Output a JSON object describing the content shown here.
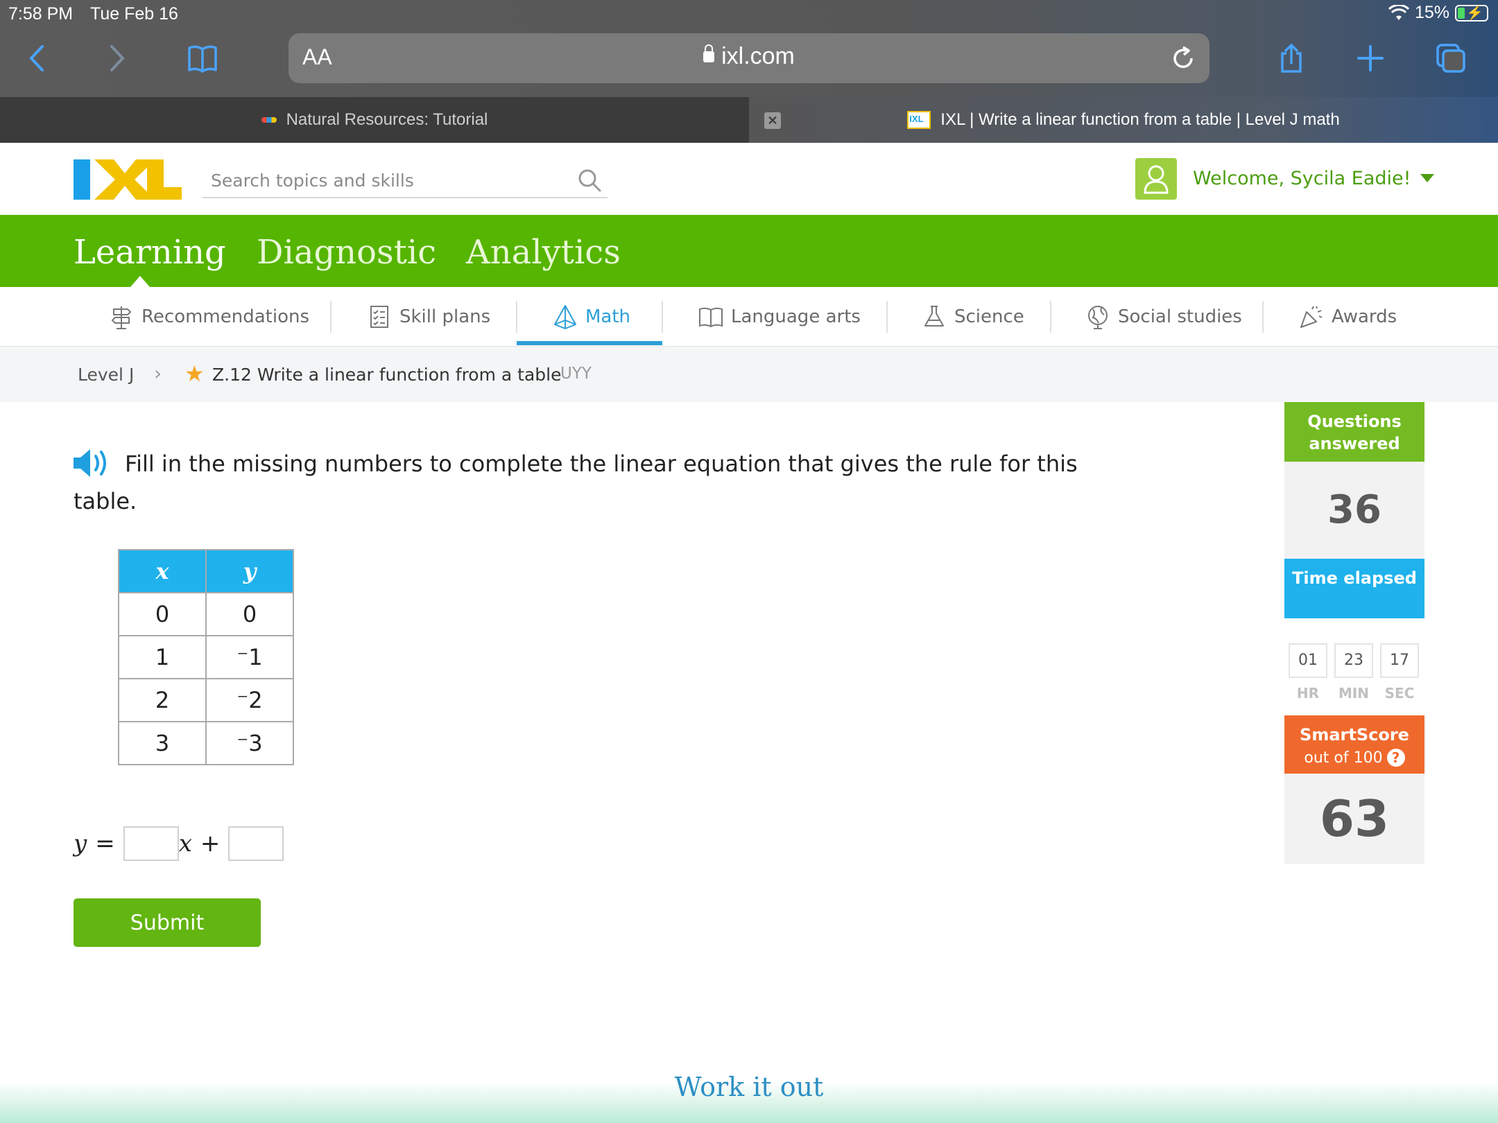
{
  "status": {
    "time": "7:58 PM",
    "date": "Tue Feb 16",
    "battery": "15%"
  },
  "browser": {
    "aa_label": "AA",
    "url": "ixl.com",
    "tabs": [
      {
        "title": "Natural Resources: Tutorial",
        "active": false
      },
      {
        "title": "IXL | Write a linear function from a table | Level J math",
        "active": true
      }
    ]
  },
  "header": {
    "search_placeholder": "Search topics and skills",
    "welcome": "Welcome, Sycila Eadie!"
  },
  "main_nav": {
    "items": [
      "Learning",
      "Diagnostic",
      "Analytics"
    ],
    "active": "Learning"
  },
  "subject_tabs": {
    "items": [
      "Recommendations",
      "Skill plans",
      "Math",
      "Language arts",
      "Science",
      "Social studies",
      "Awards"
    ],
    "active": "Math"
  },
  "breadcrumb": {
    "level": "Level J",
    "skill": "Z.12 Write a linear function from a table",
    "code": "UYY"
  },
  "question": {
    "prompt": "Fill in the missing numbers to complete the linear equation that gives the rule for this table.",
    "table": {
      "headers": [
        "x",
        "y"
      ],
      "rows": [
        [
          "0",
          "0"
        ],
        [
          "1",
          "⁻1"
        ],
        [
          "2",
          "⁻2"
        ],
        [
          "3",
          "⁻3"
        ]
      ]
    },
    "equation": {
      "lhs": "y",
      "eq": "=",
      "var": "x",
      "plus": "+"
    },
    "submit_label": "Submit"
  },
  "stats": {
    "questions_label": "Questions answered",
    "questions_value": "36",
    "time_label": "Time elapsed",
    "time": {
      "hr": "01",
      "min": "23",
      "sec": "17"
    },
    "time_units": {
      "hr": "HR",
      "min": "MIN",
      "sec": "SEC"
    },
    "smartscore_label": "SmartScore",
    "smartscore_sub": "out of 100",
    "smartscore_value": "63"
  },
  "footer": {
    "work_it_out": "Work it out"
  },
  "colors": {
    "ixl_green": "#56b500",
    "ixl_blue": "#1fb2ec",
    "ixl_orange": "#f0692c",
    "ixl_yellow": "#f2c200"
  }
}
